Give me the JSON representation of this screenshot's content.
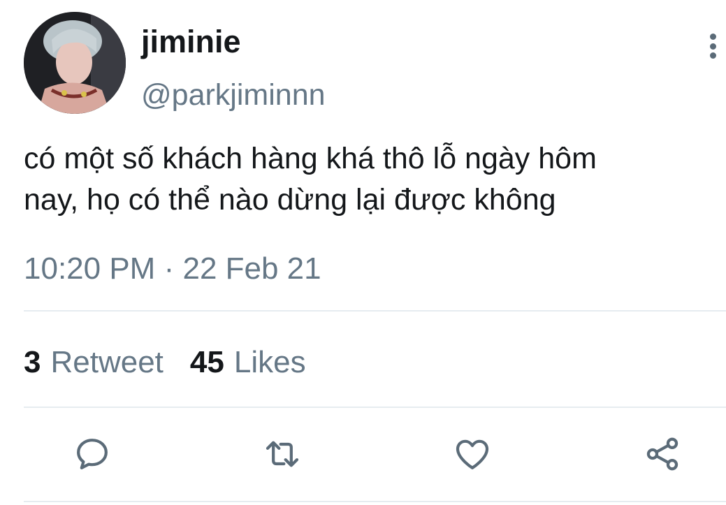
{
  "user": {
    "display_name": "jiminie",
    "handle": "@parkjiminnn"
  },
  "tweet": {
    "text": "có một số khách hàng khá thô lỗ ngày hôm\nnay, họ có thể nào dừng lại được không",
    "time": "10:20 PM",
    "separator": "·",
    "date": "22 Feb 21"
  },
  "stats": {
    "retweets_count": "3",
    "retweets_label": "Retweet",
    "likes_count": "45",
    "likes_label": "Likes"
  },
  "actions": [
    "reply-icon",
    "retweet-icon",
    "heart-icon",
    "share-icon"
  ],
  "colors": {
    "text": "#14171a",
    "secondary": "#657786",
    "divider": "#e6ecf0",
    "icon": "#5b6b78"
  }
}
